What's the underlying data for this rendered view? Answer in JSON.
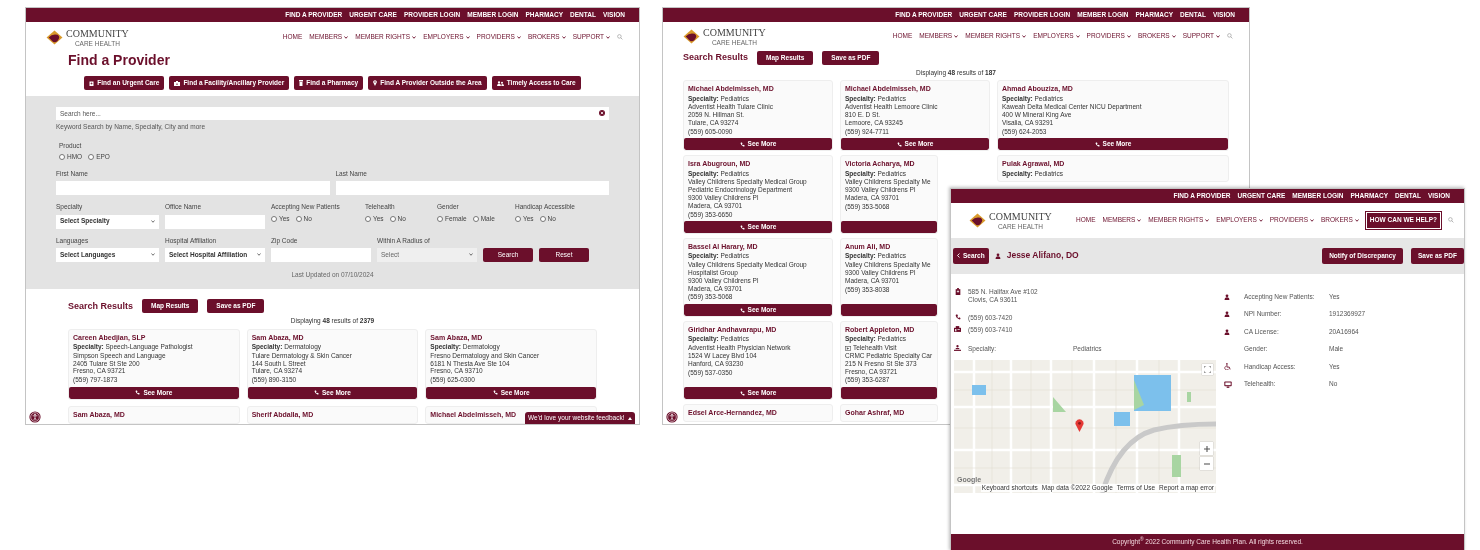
{
  "left_page": {
    "top_links": [
      "FIND A PROVIDER",
      "URGENT CARE",
      "PROVIDER LOGIN",
      "MEMBER LOGIN",
      "PHARMACY",
      "DENTAL",
      "VISION"
    ],
    "logo": {
      "name": "COMMUNITY",
      "tagline": "CARE HEALTH"
    },
    "nav": [
      {
        "label": "HOME",
        "dropdown": false
      },
      {
        "label": "MEMBERS",
        "dropdown": true
      },
      {
        "label": "MEMBER RIGHTS",
        "dropdown": true
      },
      {
        "label": "EMPLOYERS",
        "dropdown": true
      },
      {
        "label": "PROVIDERS",
        "dropdown": true
      },
      {
        "label": "BROKERS",
        "dropdown": true
      },
      {
        "label": "SUPPORT",
        "dropdown": true
      }
    ],
    "title": "Find a Provider",
    "quick_links": [
      "Find an Urgent Care",
      "Find a Facility/Ancillary Provider",
      "Find a Pharmacy",
      "Find A Provider Outside the Area",
      "Timely Access to Care"
    ],
    "search_form": {
      "search": {
        "placeholder": "Search here...",
        "hint": "Keyword Search by Name, Specialty, City and more"
      },
      "product": {
        "label": "Product",
        "options": [
          {
            "label": "HMO",
            "selected": false
          },
          {
            "label": "EPO",
            "selected": false
          }
        ]
      },
      "name_fields": [
        {
          "label": "First Name"
        },
        {
          "label": "Last Name"
        }
      ],
      "row_1": [
        {
          "kind": "select",
          "label": "Specialty",
          "value": "Select Specialty",
          "disabled": false
        },
        {
          "kind": "text",
          "label": "Office Name"
        },
        {
          "kind": "radio",
          "label": "Accepting New Patients",
          "options": [
            {
              "label": "Yes",
              "selected": false
            },
            {
              "label": "No",
              "selected": false
            }
          ]
        },
        {
          "kind": "radio",
          "label": "Telehealth",
          "options": [
            {
              "label": "Yes",
              "selected": false
            },
            {
              "label": "No",
              "selected": false
            }
          ]
        },
        {
          "kind": "radio",
          "label": "Gender",
          "options": [
            {
              "label": "Female",
              "selected": false
            },
            {
              "label": "Male",
              "selected": false
            }
          ]
        },
        {
          "kind": "radio",
          "label": "Handicap Accessible",
          "options": [
            {
              "label": "Yes",
              "selected": false
            },
            {
              "label": "No",
              "selected": false
            }
          ]
        }
      ],
      "row_2": [
        {
          "kind": "select",
          "label": "Languages",
          "value": "Select Languages",
          "disabled": false
        },
        {
          "kind": "select",
          "label": "Hospital Affiliation",
          "value": "Select Hospital Affiliation",
          "disabled": false
        },
        {
          "kind": "text",
          "label": "Zip Code"
        },
        {
          "kind": "select",
          "label": "Within A Radius of",
          "value": "Select",
          "disabled": true
        }
      ],
      "actions": [
        "Search",
        "Reset"
      ],
      "last_updated": "Last Updated on 07/10/2024"
    },
    "results": {
      "title": "Search Results",
      "buttons": [
        "Map Results",
        "Save as PDF"
      ],
      "count": "Displaying **48** results of **2379**",
      "cards": [
        {
          "name": "Careen Abedjian, SLP",
          "specialty": "**Specialty:** Speech-Language Pathologist",
          "office": "Simpson Speech and Language",
          "address": [
            "2405 Tulare St Ste 200",
            "Fresno, CA 93721"
          ],
          "phone": "(559) 797-1873",
          "has_button": true,
          "button_label": "See More"
        },
        {
          "name": "Sam Abaza, MD",
          "specialty": "**Specialty:** Dermatology",
          "office": "Tulare Dermatology & Skin Cancer",
          "address": [
            "144 South L Street",
            "Tulare, CA 93274"
          ],
          "phone": "(559) 890-3150",
          "has_button": true,
          "button_label": "See More"
        },
        {
          "name": "Sam Abaza, MD",
          "specialty": "**Specialty:** Dermatology",
          "office": "Fresno Dermatology and Skin Cancer",
          "address": [
            "6181 N Thesta Ave Ste 104",
            "Fresno, CA 93710"
          ],
          "phone": "(559) 625-0300",
          "has_button": true,
          "button_label": "See More"
        },
        {
          "name": "Sam Abaza, MD",
          "has_button": false
        },
        {
          "name": "Sherif Abdalla, MD",
          "has_button": false
        },
        {
          "name": "Michael Abdelmisseh, MD",
          "has_button": false
        }
      ]
    },
    "feedback": "We'd love your website feedback!"
  },
  "middle_page": {
    "top_links": [
      "FIND A PROVIDER",
      "URGENT CARE",
      "PROVIDER LOGIN",
      "MEMBER LOGIN",
      "PHARMACY",
      "DENTAL",
      "VISION"
    ],
    "logo": {
      "name": "COMMUNITY",
      "tagline": "CARE HEALTH"
    },
    "nav": [
      {
        "label": "HOME",
        "dropdown": false
      },
      {
        "label": "MEMBERS",
        "dropdown": true
      },
      {
        "label": "MEMBER RIGHTS",
        "dropdown": true
      },
      {
        "label": "EMPLOYERS",
        "dropdown": true
      },
      {
        "label": "PROVIDERS",
        "dropdown": true
      },
      {
        "label": "BROKERS",
        "dropdown": true
      },
      {
        "label": "SUPPORT",
        "dropdown": true
      }
    ],
    "results": {
      "title": "Search Results",
      "buttons": [
        "Map Results",
        "Save as PDF"
      ],
      "count": "Displaying **48** results of **187**",
      "cards": [
        {
          "name": "Michael Abdelmisseh, MD",
          "specialty": "**Specialty:** Pediatrics",
          "office": "Adventist Health Tulare Clinic",
          "address": [
            "2059 N. Hillman St.",
            "Tulare, CA 93274"
          ],
          "phone": "(559) 605-0090",
          "has_button": true,
          "button_label": "See More"
        },
        {
          "name": "Michael Abdelmisseh, MD",
          "specialty": "**Specialty:** Pediatrics",
          "office": "Adventist Health Lemoore Clinic",
          "address": [
            "810 E. D St.",
            "Lemoore, CA 93245"
          ],
          "phone": "(559) 924-7711",
          "has_button": true,
          "button_label": "See More"
        },
        {
          "name": "Ahmad Abouziza, MD",
          "specialty": "**Specialty:** Pediatrics",
          "office": "Kaweah Delta Medical Center NICU Department",
          "address": [
            "400 W Mineral King Ave",
            "Visalia, CA 93291"
          ],
          "phone": "(559) 624-2053",
          "has_button": true,
          "button_label": "See More"
        },
        {
          "name": "Isra Abugroun, MD",
          "specialty": "**Specialty:** Pediatrics",
          "office": "Valley Childrens Specialty Medical Group Pediatric Endocrinology Department",
          "address": [
            "9300 Valley Childrens Pl",
            "Madera, CA 93701"
          ],
          "phone": "(559) 353-6650",
          "has_button": true,
          "button_label": "See More"
        },
        {
          "name": "Victoria Acharya, MD",
          "specialty": "**Specialty:** Pediatrics",
          "office": "Valley Childrens Specialty Me",
          "address": [
            "9300 Valley Childrens Pl",
            "Madera, CA 93701"
          ],
          "phone": "(559) 353-5068",
          "has_button": true
        },
        {
          "name": "Pulak Agrawal, MD",
          "specialty": "**Specialty:** Pediatrics",
          "has_button": false
        },
        {
          "name": "Bassel Al Harary, MD",
          "specialty": "**Specialty:** Pediatrics",
          "office": "Valley Childrens Specialty Medical Group Hospitalist Group",
          "address": [
            "9300 Valley Childrens Pl",
            "Madera, CA 93701"
          ],
          "phone": "(559) 353-5068",
          "has_button": true,
          "button_label": "See More"
        },
        {
          "name": "Anum Ali, MD",
          "specialty": "**Specialty:** Pediatrics",
          "office": "Valley Childrens Specialty Me",
          "address": [
            "9300 Valley Childrens Pl",
            "Madera, CA 93701"
          ],
          "phone": "(559) 353-8038",
          "has_button": true
        },
        {
          "name": "Giridhar Andhavarapu, MD",
          "specialty": "**Specialty:** Pediatrics",
          "office": "Adventist Health Physician Network",
          "address": [
            "1524 W Lacey Blvd 104",
            "Hanford, CA 93230"
          ],
          "phone": "(559) 537-0350",
          "has_button": true,
          "button_label": "See More"
        },
        {
          "name": "Robert Appleton, MD",
          "specialty": "**Specialty:** Pediatrics",
          "telehealth": "Telehealth Visit",
          "office": "CRMC Pediatric Specialty Car",
          "address": [
            "215 N Fresno St Ste 373",
            "Fresno, CA 93721"
          ],
          "phone": "(559) 353-6287",
          "has_button": true
        },
        {
          "name": "Edsel Arce-Hernandez, MD",
          "has_button": false
        },
        {
          "name": "Gohar Ashraf, MD",
          "has_button": false
        }
      ]
    }
  },
  "detail_page": {
    "top_links": [
      "FIND A PROVIDER",
      "URGENT CARE",
      "MEMBER LOGIN",
      "PHARMACY",
      "DENTAL",
      "VISION"
    ],
    "logo": {
      "name": "COMMUNITY",
      "tagline": "CARE HEALTH"
    },
    "nav": [
      {
        "label": "HOME",
        "dropdown": false
      },
      {
        "label": "MEMBERS",
        "dropdown": true
      },
      {
        "label": "MEMBER RIGHTS",
        "dropdown": true
      },
      {
        "label": "EMPLOYERS",
        "dropdown": true
      },
      {
        "label": "PROVIDERS",
        "dropdown": true
      },
      {
        "label": "BROKERS",
        "dropdown": true
      }
    ],
    "cta": "HOW CAN WE HELP?",
    "back_button": "Search",
    "provider_name": "Jesse Alifano, DO",
    "actions": [
      "Notify of Discrepancy",
      "Save as PDF"
    ],
    "address": [
      "585 N. Halifax Ave #102",
      "Clovis, CA 93611"
    ],
    "phone": "(559) 603-7420",
    "fax": "(559) 603-7410",
    "specialty": {
      "label": "Specialty:",
      "value": "Pediatrics"
    },
    "attributes": [
      {
        "label": "Accepting New Patients:",
        "value": "Yes"
      },
      {
        "label": "NPI Number:",
        "value": "1912369927"
      },
      {
        "label": "CA License:",
        "value": "20A16964"
      },
      {
        "label": "Gender:",
        "value": "Male"
      },
      {
        "label": "Handicap Access:",
        "value": "Yes"
      },
      {
        "label": "Telehealth:",
        "value": "No"
      }
    ],
    "map": {
      "brand": "Google",
      "attribution": [
        "Keyboard shortcuts",
        "Map data ©2022 Google",
        "Terms of Use",
        "Report a map error"
      ]
    },
    "footer": "Copyright$^{®}$ 2022 Community Care Health Plan. All rights reserved."
  }
}
